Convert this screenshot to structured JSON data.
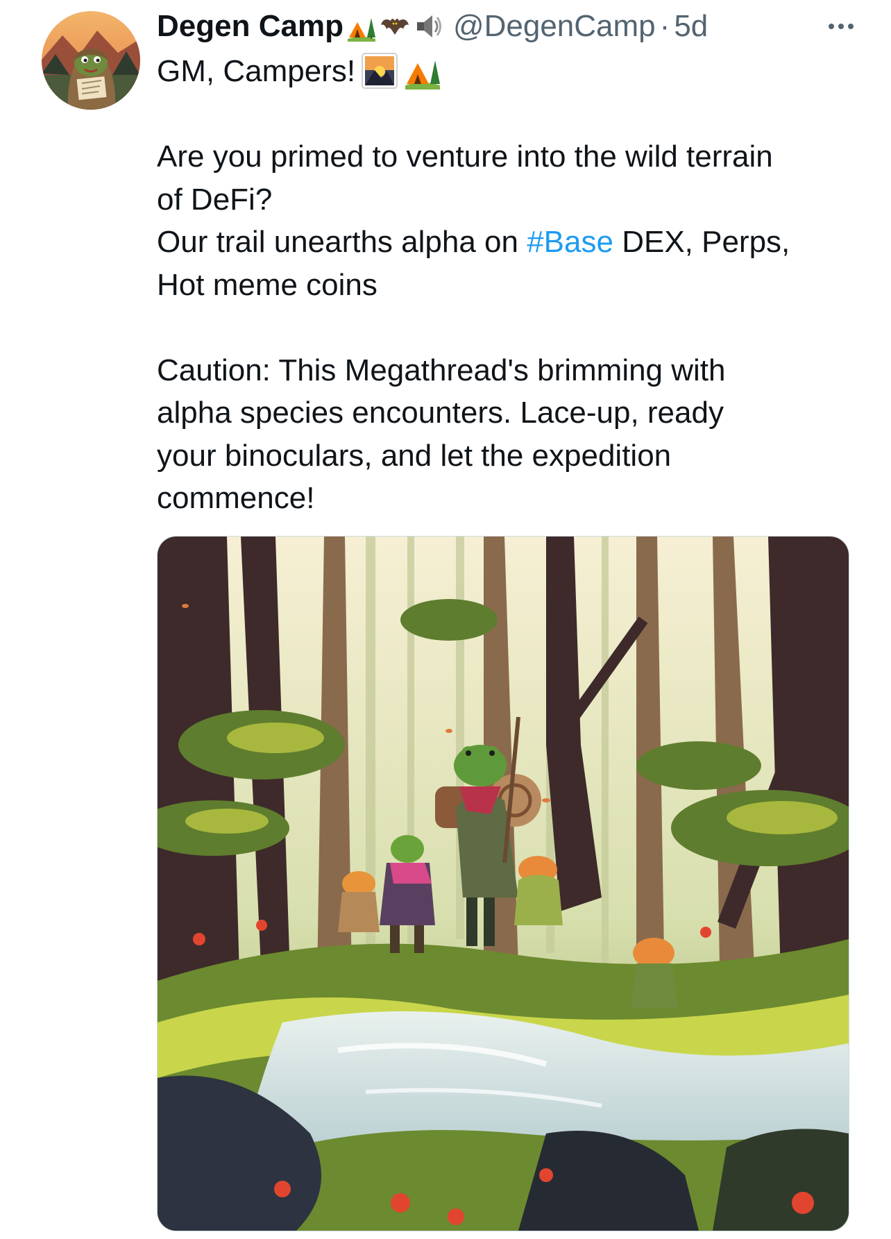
{
  "tweet": {
    "author": {
      "display_name": "Degen Camp",
      "name_emojis": [
        "camping-icon",
        "bat-icon",
        "speaker-icon"
      ],
      "handle": "@DegenCamp",
      "separator": "·",
      "time": "5d"
    },
    "more_icon": "ellipsis-icon",
    "body": {
      "line1": "GM, Campers!",
      "line1_emojis": [
        "sunrise-mountains-icon",
        "camping-icon"
      ],
      "line2": "Are you primed to venture into the wild terrain",
      "line3": "of DeFi?",
      "line4_before": "Our trail unearths alpha on ",
      "hashtag": "#Base",
      "line4_after": " DEX, Perps,",
      "line5": "Hot meme coins",
      "line6": "Caution: This Megathread's brimming with",
      "line7": "alpha species encounters. Lace-up, ready",
      "line8": "your binoculars, and let the expedition",
      "line9": "commence!"
    },
    "media": {
      "kind": "illustration",
      "subject": "frog-adventurers-forest-stream"
    }
  },
  "colors": {
    "text": "#0f1419",
    "muted": "#536471",
    "link": "#1d9bf0",
    "border": "#cfd9de"
  }
}
